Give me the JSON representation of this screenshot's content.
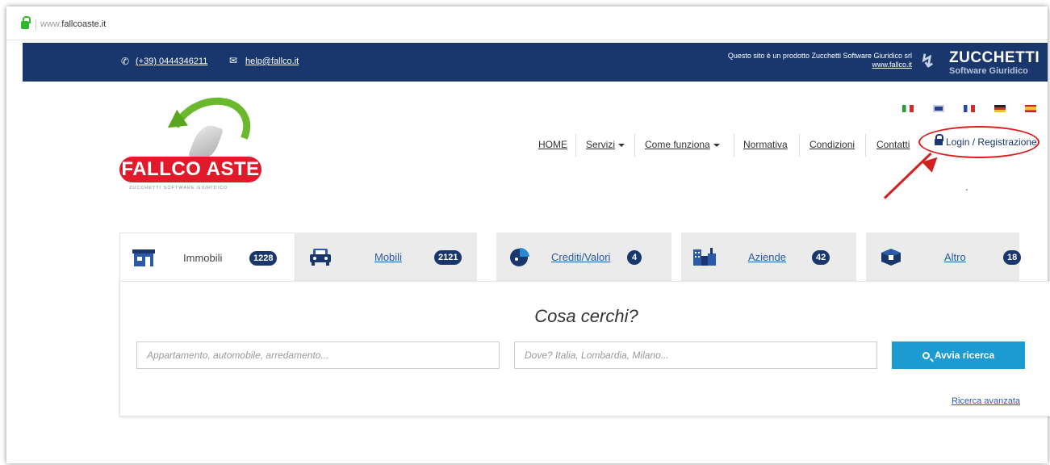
{
  "browser": {
    "url_prefix": "www.",
    "url_domain": "fallcoaste.it"
  },
  "topbar": {
    "phone": "(+39) 0444346211",
    "email": "help@fallco.it",
    "product_note": "Questo sito è un prodotto Zucchetti Software Giuridico srl",
    "product_link": "www.fallco.it",
    "brand_title": "ZUCCHETTI",
    "brand_subtitle": "Software Giuridico"
  },
  "logo": {
    "name": "FALLCO ASTE",
    "tagline": "ZUCCHETTI SOFTWARE GIURIDICO"
  },
  "languages": [
    "it",
    "en",
    "fr",
    "de",
    "es"
  ],
  "nav": {
    "items": [
      {
        "label": "HOME"
      },
      {
        "label": "Servizi",
        "dropdown": true
      },
      {
        "label": "Come funziona",
        "dropdown": true
      },
      {
        "label": "Normativa"
      },
      {
        "label": "Condizioni"
      },
      {
        "label": "Contatti"
      }
    ],
    "login": "Login / Registrazione",
    "highlight_color": "#e01a1a"
  },
  "tabs": [
    {
      "label": "Immobili",
      "count": "1228",
      "icon": "house-icon",
      "active": true
    },
    {
      "label": "Mobili",
      "count": "2121",
      "icon": "car-icon",
      "active": false
    },
    {
      "label": "Crediti/Valori",
      "count": "4",
      "icon": "pie-chart-icon",
      "active": false
    },
    {
      "label": "Aziende",
      "count": "42",
      "icon": "factory-icon",
      "active": false
    },
    {
      "label": "Altro",
      "count": "18",
      "icon": "box-icon",
      "active": false
    }
  ],
  "search": {
    "title": "Cosa cerchi?",
    "what_placeholder": "Appartamento, automobile, arredamento...",
    "where_placeholder": "Dove? Italia, Lombardia, Milano...",
    "button": "Avvia ricerca",
    "advanced": "Ricerca avanzata"
  },
  "colors": {
    "navy": "#19376d",
    "brand_red": "#e01a2b",
    "accent_blue": "#1b9bd1",
    "logo_green": "#6ab82e"
  }
}
